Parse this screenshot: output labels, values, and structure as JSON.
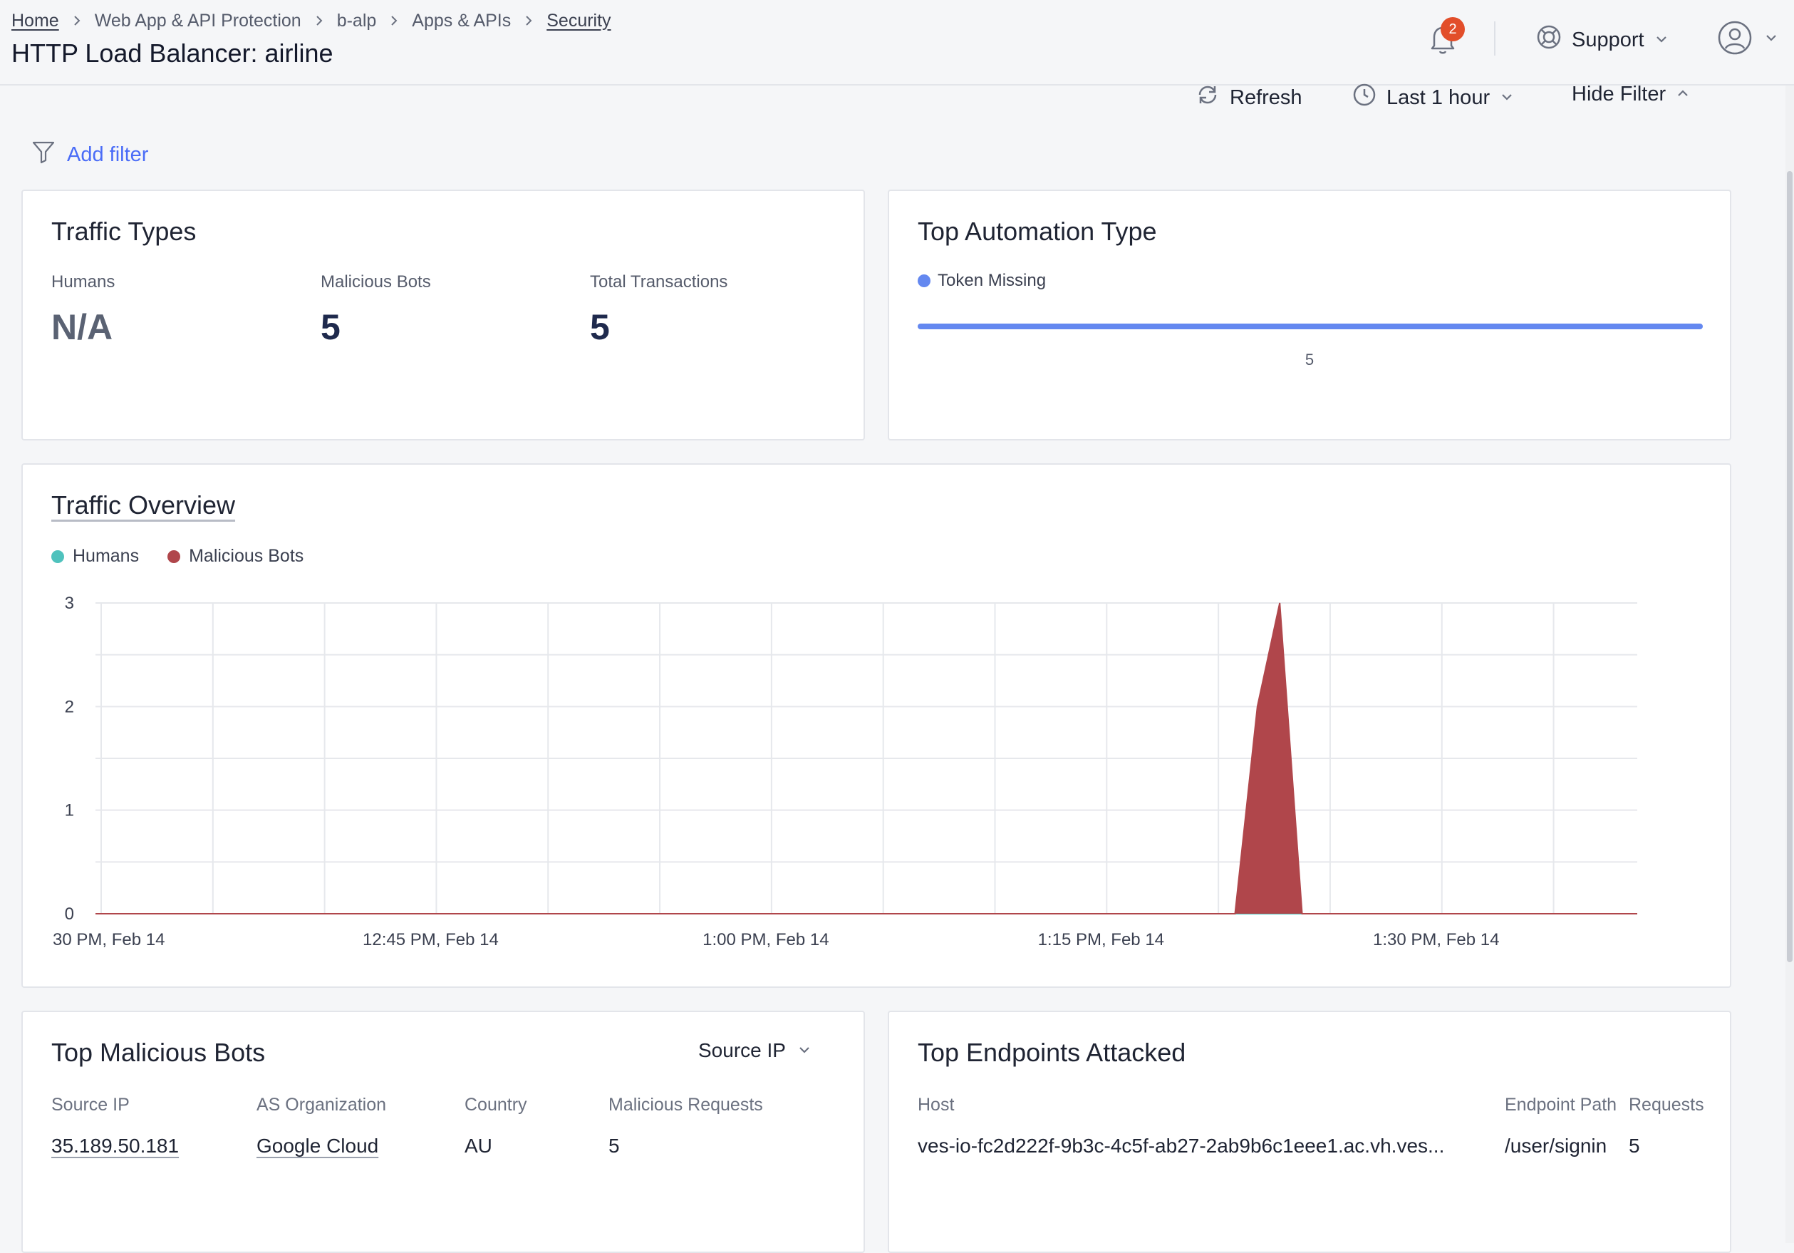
{
  "breadcrumb": {
    "home": "Home",
    "item1": "Web App & API Protection",
    "item2": "b-alp",
    "item3": "Apps & APIs",
    "current": "Security"
  },
  "page_title": "HTTP Load Balancer: airline",
  "header": {
    "notifications_count": "2",
    "support_label": "Support"
  },
  "toolbar": {
    "refresh_label": "Refresh",
    "time_range_label": "Last 1 hour",
    "hide_filter_label": "Hide Filter"
  },
  "filter": {
    "add_filter_label": "Add filter"
  },
  "traffic_types": {
    "title": "Traffic Types",
    "humans_label": "Humans",
    "humans_value": "N/A",
    "malicious_bots_label": "Malicious Bots",
    "malicious_bots_value": "5",
    "total_transactions_label": "Total Transactions",
    "total_transactions_value": "5"
  },
  "top_automation": {
    "title": "Top Automation Type",
    "legend_label": "Token Missing",
    "bar_value": "5",
    "bar_color": "#6488f0"
  },
  "traffic_overview": {
    "title": "Traffic Overview",
    "legend": [
      {
        "label": "Humans",
        "color": "#4fc2bd"
      },
      {
        "label": "Malicious Bots",
        "color": "#b0464b"
      }
    ]
  },
  "chart_data": {
    "type": "area",
    "y_ticks": [
      "3",
      "2",
      "1",
      "0"
    ],
    "ylim": [
      0,
      3
    ],
    "x_tick_labels": [
      "30 PM, Feb 14",
      "12:45 PM, Feb 14",
      "1:00 PM, Feb 14",
      "1:15 PM, Feb 14",
      "1:30 PM, Feb 14"
    ],
    "x_start_minutes": 0,
    "x_end_minutes": 69,
    "x_tick_minutes": [
      0,
      15,
      30,
      45,
      60
    ],
    "grid": true,
    "series": [
      {
        "name": "Humans",
        "color": "#4fc2bd",
        "points": [
          [
            0,
            0
          ],
          [
            69,
            0
          ]
        ]
      },
      {
        "name": "Malicious Bots",
        "color": "#b0464b",
        "points": [
          [
            0,
            0
          ],
          [
            51,
            0
          ],
          [
            52,
            2
          ],
          [
            53,
            3
          ],
          [
            54,
            0
          ],
          [
            69,
            0
          ]
        ]
      }
    ]
  },
  "top_malicious_bots": {
    "title": "Top Malicious Bots",
    "selector_label": "Source IP",
    "columns": [
      "Source IP",
      "AS Organization",
      "Country",
      "Malicious Requests"
    ],
    "rows": [
      {
        "source_ip": "35.189.50.181",
        "as_org": "Google Cloud",
        "country": "AU",
        "requests": "5"
      }
    ]
  },
  "top_endpoints": {
    "title": "Top Endpoints Attacked",
    "columns": [
      "Host",
      "Endpoint Path",
      "Requests"
    ],
    "rows": [
      {
        "host": "ves-io-fc2d222f-9b3c-4c5f-ab27-2ab9b6c1eee1.ac.vh.ves...",
        "path": "/user/signin",
        "requests": "5"
      }
    ]
  }
}
